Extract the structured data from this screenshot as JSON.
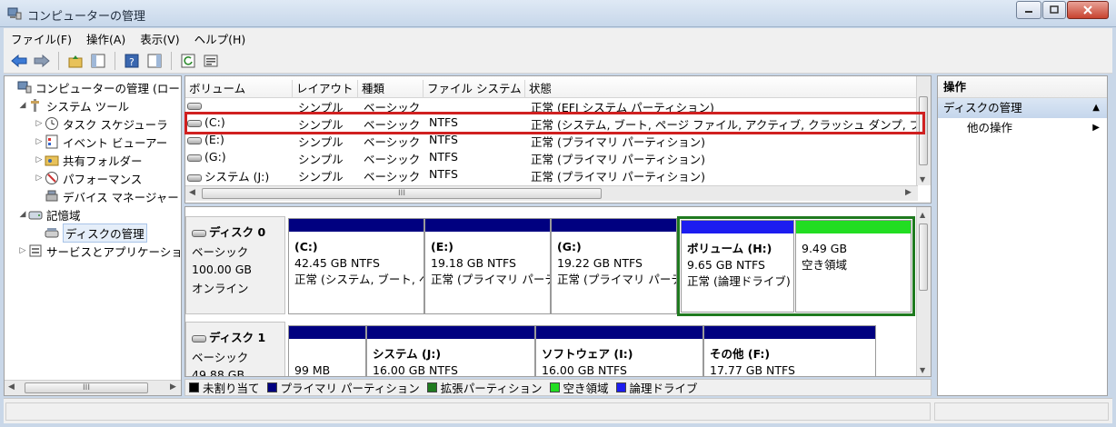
{
  "window": {
    "title": "コンピューターの管理"
  },
  "menu": [
    "ファイル(F)",
    "操作(A)",
    "表示(V)",
    "ヘルプ(H)"
  ],
  "tree": [
    {
      "label": "コンピューターの管理 (ローカ",
      "level": 0,
      "expander": "",
      "icon": "computer-icon"
    },
    {
      "label": "システム ツール",
      "level": 1,
      "expander": "◢",
      "icon": "tools-icon"
    },
    {
      "label": "タスク スケジューラ",
      "level": 2,
      "expander": "▷",
      "icon": "clock-icon"
    },
    {
      "label": "イベント ビューアー",
      "level": 2,
      "expander": "▷",
      "icon": "event-icon"
    },
    {
      "label": "共有フォルダー",
      "level": 2,
      "expander": "▷",
      "icon": "shared-folder-icon"
    },
    {
      "label": "パフォーマンス",
      "level": 2,
      "expander": "▷",
      "icon": "performance-icon"
    },
    {
      "label": "デバイス マネージャー",
      "level": 2,
      "expander": "",
      "icon": "device-manager-icon"
    },
    {
      "label": "記憶域",
      "level": 1,
      "expander": "◢",
      "icon": "storage-icon"
    },
    {
      "label": "ディスクの管理",
      "level": 2,
      "expander": "",
      "icon": "disk-management-icon",
      "selected": true
    },
    {
      "label": "サービスとアプリケーショ",
      "level": 1,
      "expander": "▷",
      "icon": "services-icon"
    }
  ],
  "columns": [
    "ボリューム",
    "レイアウト",
    "種類",
    "ファイル システム",
    "状態"
  ],
  "volumes": [
    {
      "name": "",
      "layout": "シンプル",
      "type": "ベーシック",
      "fs": "",
      "status": "正常 (EFI システム パーティション)"
    },
    {
      "name": "(C:)",
      "layout": "シンプル",
      "type": "ベーシック",
      "fs": "NTFS",
      "status": "正常 (システム, ブート, ページ ファイル, アクティブ, クラッシュ ダンプ, プラ"
    },
    {
      "name": "(E:)",
      "layout": "シンプル",
      "type": "ベーシック",
      "fs": "NTFS",
      "status": "正常 (プライマリ パーティション)"
    },
    {
      "name": "(G:)",
      "layout": "シンプル",
      "type": "ベーシック",
      "fs": "NTFS",
      "status": "正常 (プライマリ パーティション)"
    },
    {
      "name": "システム (J:)",
      "layout": "シンプル",
      "type": "ベーシック",
      "fs": "NTFS",
      "status": "正常 (プライマリ パーティション)"
    }
  ],
  "disk0": {
    "name": "ディスク 0",
    "type": "ベーシック",
    "size": "100.00 GB",
    "state": "オンライン",
    "partitions": [
      {
        "name": "(C:)",
        "size": "42.45 GB NTFS",
        "status": "正常 (システム, ブート, ペ",
        "color": "#000080"
      },
      {
        "name": "(E:)",
        "size": "19.18 GB NTFS",
        "status": "正常 (プライマリ パーテ",
        "color": "#000080"
      },
      {
        "name": "(G:)",
        "size": "19.22 GB NTFS",
        "status": "正常 (プライマリ パーテ",
        "color": "#000080"
      },
      {
        "name": "ボリューム (H:)",
        "size": "9.65 GB NTFS",
        "status": "正常 (論理ドライブ)",
        "color": "#1c1cf0"
      },
      {
        "name": "",
        "size": "9.49 GB",
        "status": "空き領域",
        "color": "#22dd22"
      }
    ]
  },
  "disk1": {
    "name": "ディスク 1",
    "type": "ベーシック",
    "size": "49.88 GB",
    "partitions": [
      {
        "name": "",
        "size": "99 MB",
        "status": "",
        "color": "#000080"
      },
      {
        "name": "システム (J:)",
        "size": "16.00 GB NTFS",
        "status": "",
        "color": "#000080"
      },
      {
        "name": "ソフトウェア (I:)",
        "size": "16.00 GB NTFS",
        "status": "",
        "color": "#000080"
      },
      {
        "name": "その他 (F:)",
        "size": "17.77 GB NTFS",
        "status": "",
        "color": "#000080"
      }
    ]
  },
  "legend": [
    {
      "label": "未割り当て",
      "color": "#000000"
    },
    {
      "label": "プライマリ パーティション",
      "color": "#000080"
    },
    {
      "label": "拡張パーティション",
      "color": "#1f7a1f"
    },
    {
      "label": "空き領域",
      "color": "#22dd22"
    },
    {
      "label": "論理ドライブ",
      "color": "#1c1cf0"
    }
  ],
  "actions": {
    "header": "操作",
    "section": "ディスクの管理",
    "item": "他の操作"
  },
  "scroll": {
    "tree_h": "III",
    "list_h": "III"
  }
}
